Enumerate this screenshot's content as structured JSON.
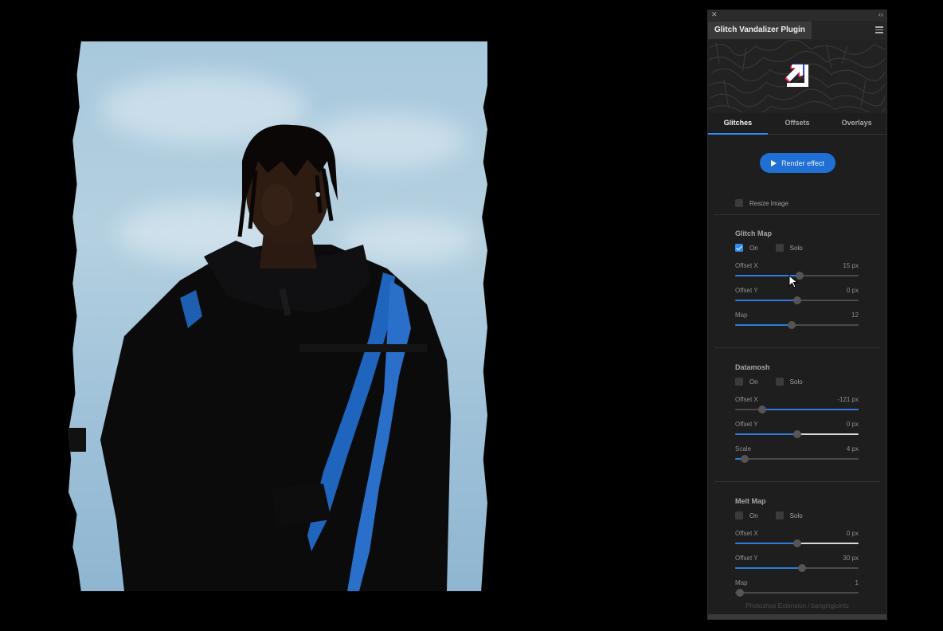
{
  "panel": {
    "title": "Glitch Vandalizer Plugin",
    "close_glyph": "✕",
    "collapse_glyph": "‹‹",
    "tabs": [
      {
        "label": "Glitches",
        "active": true
      },
      {
        "label": "Offsets",
        "active": false
      },
      {
        "label": "Overlays",
        "active": false
      }
    ],
    "render_button": "Render effect",
    "resize_image": {
      "label": "Resize Image",
      "checked": false
    },
    "sections": [
      {
        "title": "Glitch Map",
        "on": {
          "label": "On",
          "checked": true
        },
        "solo": {
          "label": "Solo",
          "checked": false
        },
        "sliders": [
          {
            "label": "Offset X",
            "value": "15 px",
            "level": 0.52,
            "fill": "partial"
          },
          {
            "label": "Offset Y",
            "value": "0 px",
            "level": 0.5,
            "fill": "partial"
          },
          {
            "label": "Map",
            "value": "12",
            "level": 0.46,
            "fill": "partial"
          }
        ]
      },
      {
        "title": "Datamosh",
        "on": {
          "label": "On",
          "checked": false
        },
        "solo": {
          "label": "Solo",
          "checked": false
        },
        "sliders": [
          {
            "label": "Offset X",
            "value": "-121 px",
            "level": 0.22,
            "fill": "right"
          },
          {
            "label": "Offset Y",
            "value": "0 px",
            "level": 0.5,
            "fill": "full"
          },
          {
            "label": "Scale",
            "value": "4 px",
            "level": 0.08,
            "fill": "partial"
          }
        ]
      },
      {
        "title": "Melt Map",
        "on": {
          "label": "On",
          "checked": false
        },
        "solo": {
          "label": "Solo",
          "checked": false
        },
        "sliders": [
          {
            "label": "Offset X",
            "value": "0 px",
            "level": 0.5,
            "fill": "full"
          },
          {
            "label": "Offset Y",
            "value": "30 px",
            "level": 0.54,
            "fill": "partial"
          },
          {
            "label": "Map",
            "value": "1",
            "level": 0.04,
            "fill": "none"
          }
        ]
      }
    ],
    "footer": "Photoshop Extension / bangingjoints"
  },
  "colors": {
    "accent": "#2f8cf0",
    "button": "#1f6fd4",
    "panel_bg": "#1e1e1e",
    "canvas_bg": "#000000"
  },
  "icons": [
    "close-icon",
    "collapse-icon",
    "menu-icon",
    "logo-icon",
    "play-icon",
    "cursor-icon"
  ]
}
